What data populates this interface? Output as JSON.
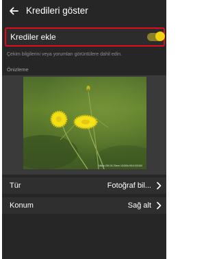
{
  "header": {
    "title": "Kredileri göster",
    "back_icon": "arrow-left-icon"
  },
  "credits_toggle": {
    "label": "Krediler ekle",
    "state": "on",
    "accent_color": "#f1d20f",
    "highlight_color": "#e00d1e"
  },
  "description": "Çekim bilgilerini veya yorumları görüntülere dahil edin.",
  "preview": {
    "label": "Önizleme",
    "photo_credit": "Nikon Z5II 24-70mm 1/1000s f/5.6 ISO100"
  },
  "settings": {
    "type": {
      "label": "Tür",
      "value": "Fotoğraf bil..."
    },
    "position": {
      "label": "Konum",
      "value": "Sağ alt"
    }
  }
}
